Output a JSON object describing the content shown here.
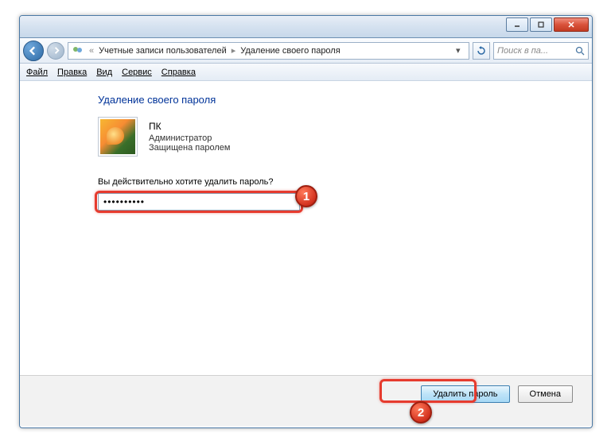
{
  "titlebar": {
    "minimize_tip": "Свернуть",
    "maximize_tip": "Развернуть",
    "close_tip": "Закрыть"
  },
  "nav": {
    "breadcrumb_root": "Учетные записи пользователей",
    "breadcrumb_page": "Удаление своего пароля",
    "search_placeholder": "Поиск в па..."
  },
  "menu": {
    "file": "Файл",
    "edit": "Правка",
    "view": "Вид",
    "tools": "Сервис",
    "help": "Справка"
  },
  "main": {
    "title": "Удаление своего пароля",
    "user": {
      "name": "ПК",
      "role": "Администратор",
      "protected": "Защищена паролем"
    },
    "prompt": "Вы действительно хотите удалить пароль?",
    "password_value": "••••••••••"
  },
  "footer": {
    "primary_label": "Удалить пароль",
    "cancel_label": "Отмена"
  },
  "annotations": {
    "badge1": "1",
    "badge2": "2"
  }
}
